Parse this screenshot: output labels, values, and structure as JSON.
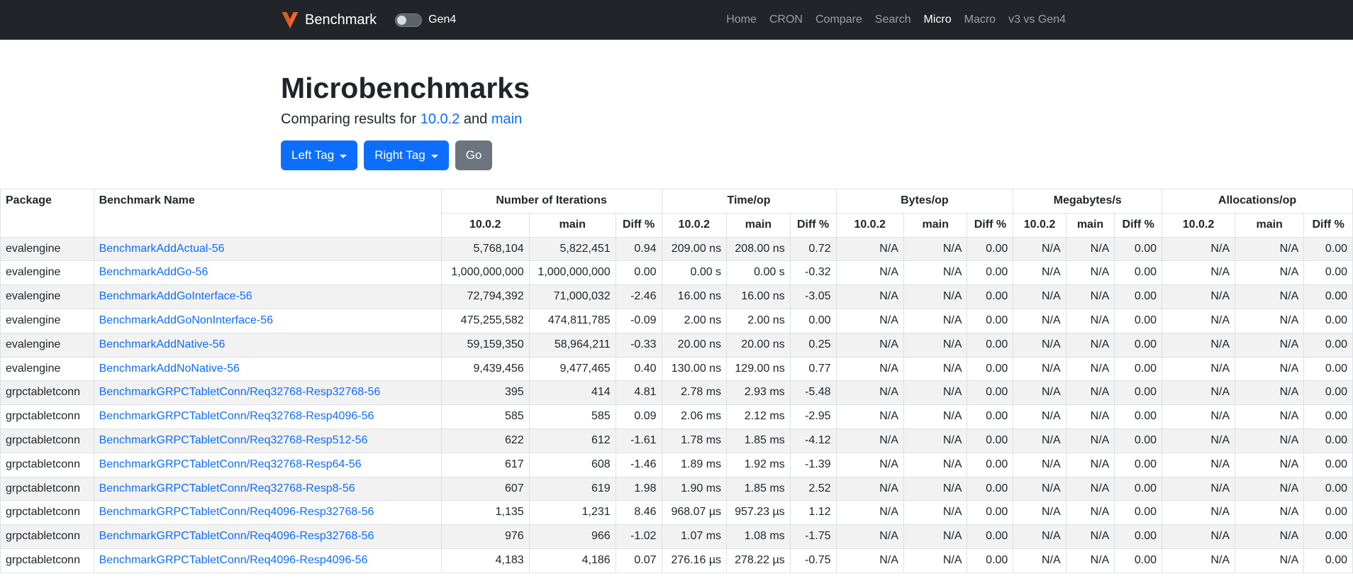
{
  "navbar": {
    "brand": "Benchmark",
    "toggle_label": "Gen4",
    "links": [
      {
        "label": "Home",
        "active": false
      },
      {
        "label": "CRON",
        "active": false
      },
      {
        "label": "Compare",
        "active": false
      },
      {
        "label": "Search",
        "active": false
      },
      {
        "label": "Micro",
        "active": true
      },
      {
        "label": "Macro",
        "active": false
      },
      {
        "label": "v3 vs Gen4",
        "active": false
      }
    ]
  },
  "header": {
    "title": "Microbenchmarks",
    "subtitle_prefix": "Comparing results for",
    "left_tag_link": "10.0.2",
    "subtitle_and": "and",
    "right_tag_link": "main",
    "left_tag_button": "Left Tag",
    "right_tag_button": "Right Tag",
    "go_button": "Go"
  },
  "colors": {
    "accent_blue": "#0d6efd",
    "secondary_gray": "#6c757d",
    "navbar_bg": "#212529",
    "logo_orange": "#f16728",
    "stripe": "#f2f2f2",
    "border": "#dee2e6"
  },
  "table": {
    "col1": "Package",
    "col2": "Benchmark Name",
    "groups": [
      "Number of Iterations",
      "Time/op",
      "Bytes/op",
      "Megabytes/s",
      "Allocations/op"
    ],
    "sub_headers": [
      "10.0.2",
      "main",
      "Diff %"
    ],
    "rows": [
      {
        "package": "evalengine",
        "name": "BenchmarkAddActual-56",
        "values": [
          "5,768,104",
          "5,822,451",
          "0.94",
          "209.00 ns",
          "208.00 ns",
          "0.72",
          "N/A",
          "N/A",
          "0.00",
          "N/A",
          "N/A",
          "0.00",
          "N/A",
          "N/A",
          "0.00"
        ]
      },
      {
        "package": "evalengine",
        "name": "BenchmarkAddGo-56",
        "values": [
          "1,000,000,000",
          "1,000,000,000",
          "0.00",
          "0.00 s",
          "0.00 s",
          "-0.32",
          "N/A",
          "N/A",
          "0.00",
          "N/A",
          "N/A",
          "0.00",
          "N/A",
          "N/A",
          "0.00"
        ]
      },
      {
        "package": "evalengine",
        "name": "BenchmarkAddGoInterface-56",
        "values": [
          "72,794,392",
          "71,000,032",
          "-2.46",
          "16.00 ns",
          "16.00 ns",
          "-3.05",
          "N/A",
          "N/A",
          "0.00",
          "N/A",
          "N/A",
          "0.00",
          "N/A",
          "N/A",
          "0.00"
        ]
      },
      {
        "package": "evalengine",
        "name": "BenchmarkAddGoNonInterface-56",
        "values": [
          "475,255,582",
          "474,811,785",
          "-0.09",
          "2.00 ns",
          "2.00 ns",
          "0.00",
          "N/A",
          "N/A",
          "0.00",
          "N/A",
          "N/A",
          "0.00",
          "N/A",
          "N/A",
          "0.00"
        ]
      },
      {
        "package": "evalengine",
        "name": "BenchmarkAddNative-56",
        "values": [
          "59,159,350",
          "58,964,211",
          "-0.33",
          "20.00 ns",
          "20.00 ns",
          "0.25",
          "N/A",
          "N/A",
          "0.00",
          "N/A",
          "N/A",
          "0.00",
          "N/A",
          "N/A",
          "0.00"
        ]
      },
      {
        "package": "evalengine",
        "name": "BenchmarkAddNoNative-56",
        "values": [
          "9,439,456",
          "9,477,465",
          "0.40",
          "130.00 ns",
          "129.00 ns",
          "0.77",
          "N/A",
          "N/A",
          "0.00",
          "N/A",
          "N/A",
          "0.00",
          "N/A",
          "N/A",
          "0.00"
        ]
      },
      {
        "package": "grpctabletconn",
        "name": "BenchmarkGRPCTabletConn/Req32768-Resp32768-56",
        "values": [
          "395",
          "414",
          "4.81",
          "2.78 ms",
          "2.93 ms",
          "-5.48",
          "N/A",
          "N/A",
          "0.00",
          "N/A",
          "N/A",
          "0.00",
          "N/A",
          "N/A",
          "0.00"
        ]
      },
      {
        "package": "grpctabletconn",
        "name": "BenchmarkGRPCTabletConn/Req32768-Resp4096-56",
        "values": [
          "585",
          "585",
          "0.09",
          "2.06 ms",
          "2.12 ms",
          "-2.95",
          "N/A",
          "N/A",
          "0.00",
          "N/A",
          "N/A",
          "0.00",
          "N/A",
          "N/A",
          "0.00"
        ]
      },
      {
        "package": "grpctabletconn",
        "name": "BenchmarkGRPCTabletConn/Req32768-Resp512-56",
        "values": [
          "622",
          "612",
          "-1.61",
          "1.78 ms",
          "1.85 ms",
          "-4.12",
          "N/A",
          "N/A",
          "0.00",
          "N/A",
          "N/A",
          "0.00",
          "N/A",
          "N/A",
          "0.00"
        ]
      },
      {
        "package": "grpctabletconn",
        "name": "BenchmarkGRPCTabletConn/Req32768-Resp64-56",
        "values": [
          "617",
          "608",
          "-1.46",
          "1.89 ms",
          "1.92 ms",
          "-1.39",
          "N/A",
          "N/A",
          "0.00",
          "N/A",
          "N/A",
          "0.00",
          "N/A",
          "N/A",
          "0.00"
        ]
      },
      {
        "package": "grpctabletconn",
        "name": "BenchmarkGRPCTabletConn/Req32768-Resp8-56",
        "values": [
          "607",
          "619",
          "1.98",
          "1.90 ms",
          "1.85 ms",
          "2.52",
          "N/A",
          "N/A",
          "0.00",
          "N/A",
          "N/A",
          "0.00",
          "N/A",
          "N/A",
          "0.00"
        ]
      },
      {
        "package": "grpctabletconn",
        "name": "BenchmarkGRPCTabletConn/Req4096-Resp32768-56",
        "values": [
          "1,135",
          "1,231",
          "8.46",
          "968.07 µs",
          "957.23 µs",
          "1.12",
          "N/A",
          "N/A",
          "0.00",
          "N/A",
          "N/A",
          "0.00",
          "N/A",
          "N/A",
          "0.00"
        ]
      },
      {
        "package": "grpctabletconn",
        "name": "BenchmarkGRPCTabletConn/Req4096-Resp32768-56",
        "values": [
          "976",
          "966",
          "-1.02",
          "1.07 ms",
          "1.08 ms",
          "-1.75",
          "N/A",
          "N/A",
          "0.00",
          "N/A",
          "N/A",
          "0.00",
          "N/A",
          "N/A",
          "0.00"
        ]
      },
      {
        "package": "grpctabletconn",
        "name": "BenchmarkGRPCTabletConn/Req4096-Resp4096-56",
        "values": [
          "4,183",
          "4,186",
          "0.07",
          "276.16 µs",
          "278.22 µs",
          "-0.75",
          "N/A",
          "N/A",
          "0.00",
          "N/A",
          "N/A",
          "0.00",
          "N/A",
          "N/A",
          "0.00"
        ]
      }
    ]
  }
}
